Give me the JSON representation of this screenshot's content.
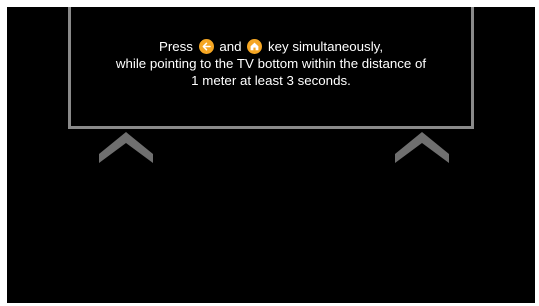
{
  "instruction": {
    "line1_part1": "Press",
    "line1_part2": "and",
    "line1_part3": "key simultaneously,",
    "line2": "while pointing to the TV bottom within the distance of",
    "line3": "1 meter at least 3 seconds."
  },
  "icons": {
    "back_key": "back-arrow-icon",
    "home_key": "home-icon",
    "key_color": "#f5a623"
  },
  "colors": {
    "background": "#000000",
    "tv_outline": "#8a8a8a",
    "text": "#ffffff"
  }
}
